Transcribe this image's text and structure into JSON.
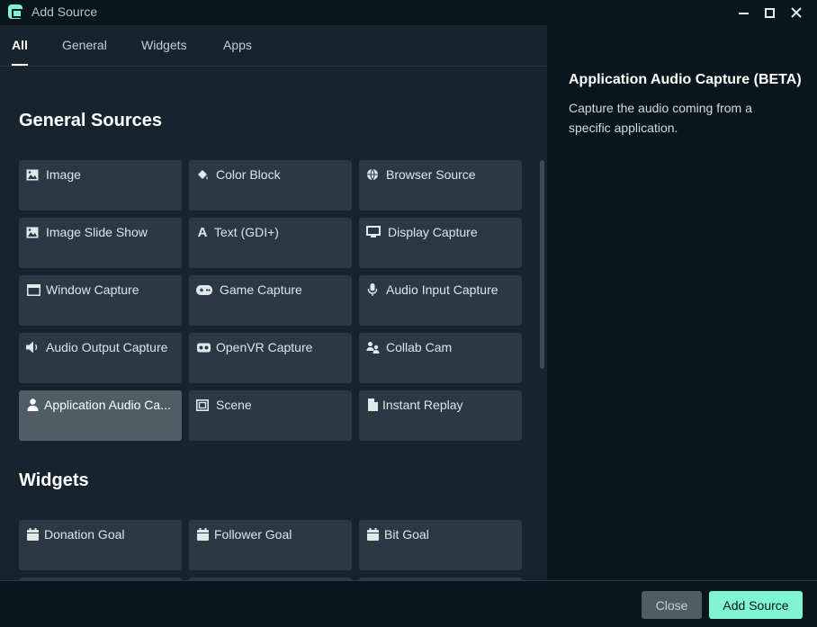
{
  "window": {
    "title": "Add Source",
    "minimize_icon": "minimize-icon",
    "maximize_icon": "maximize-icon",
    "close_icon": "close-icon"
  },
  "tabs": [
    {
      "label": "All",
      "active": true
    },
    {
      "label": "General",
      "active": false
    },
    {
      "label": "Widgets",
      "active": false
    },
    {
      "label": "Apps",
      "active": false
    }
  ],
  "general_sources": {
    "title": "General Sources",
    "items": [
      {
        "label": "Image",
        "icon": "image-icon"
      },
      {
        "label": "Color Block",
        "icon": "paint-bucket-icon"
      },
      {
        "label": "Browser Source",
        "icon": "globe-icon"
      },
      {
        "label": "Image Slide Show",
        "icon": "image-icon"
      },
      {
        "label": "Text (GDI+)",
        "icon": "text-icon"
      },
      {
        "label": "Display Capture",
        "icon": "monitor-icon"
      },
      {
        "label": "Window Capture",
        "icon": "window-icon"
      },
      {
        "label": "Game Capture",
        "icon": "gamepad-icon"
      },
      {
        "label": "Audio Input Capture",
        "icon": "microphone-icon"
      },
      {
        "label": "Audio Output Capture",
        "icon": "speaker-icon"
      },
      {
        "label": "OpenVR Capture",
        "icon": "vr-headset-icon"
      },
      {
        "label": "Collab Cam",
        "icon": "users-icon"
      },
      {
        "label": "Application Audio Ca...",
        "icon": "user-icon",
        "selected": true
      },
      {
        "label": "Scene",
        "icon": "scene-icon"
      },
      {
        "label": "Instant Replay",
        "icon": "file-icon"
      }
    ]
  },
  "widgets": {
    "title": "Widgets",
    "items": [
      {
        "label": "Donation Goal",
        "icon": "calendar-icon"
      },
      {
        "label": "Follower Goal",
        "icon": "calendar-icon"
      },
      {
        "label": "Bit Goal",
        "icon": "calendar-icon"
      }
    ]
  },
  "detail": {
    "title": "Application Audio Capture (BETA)",
    "description": "Capture the audio coming from a specific application."
  },
  "footer": {
    "close_label": "Close",
    "add_label": "Add Source"
  },
  "colors": {
    "accent": "#80f5d2",
    "card_bg": "#2b3a42",
    "card_selected_bg": "#4f5e65",
    "panel_bg": "#17242d",
    "sidebar_bg": "#09161d"
  }
}
